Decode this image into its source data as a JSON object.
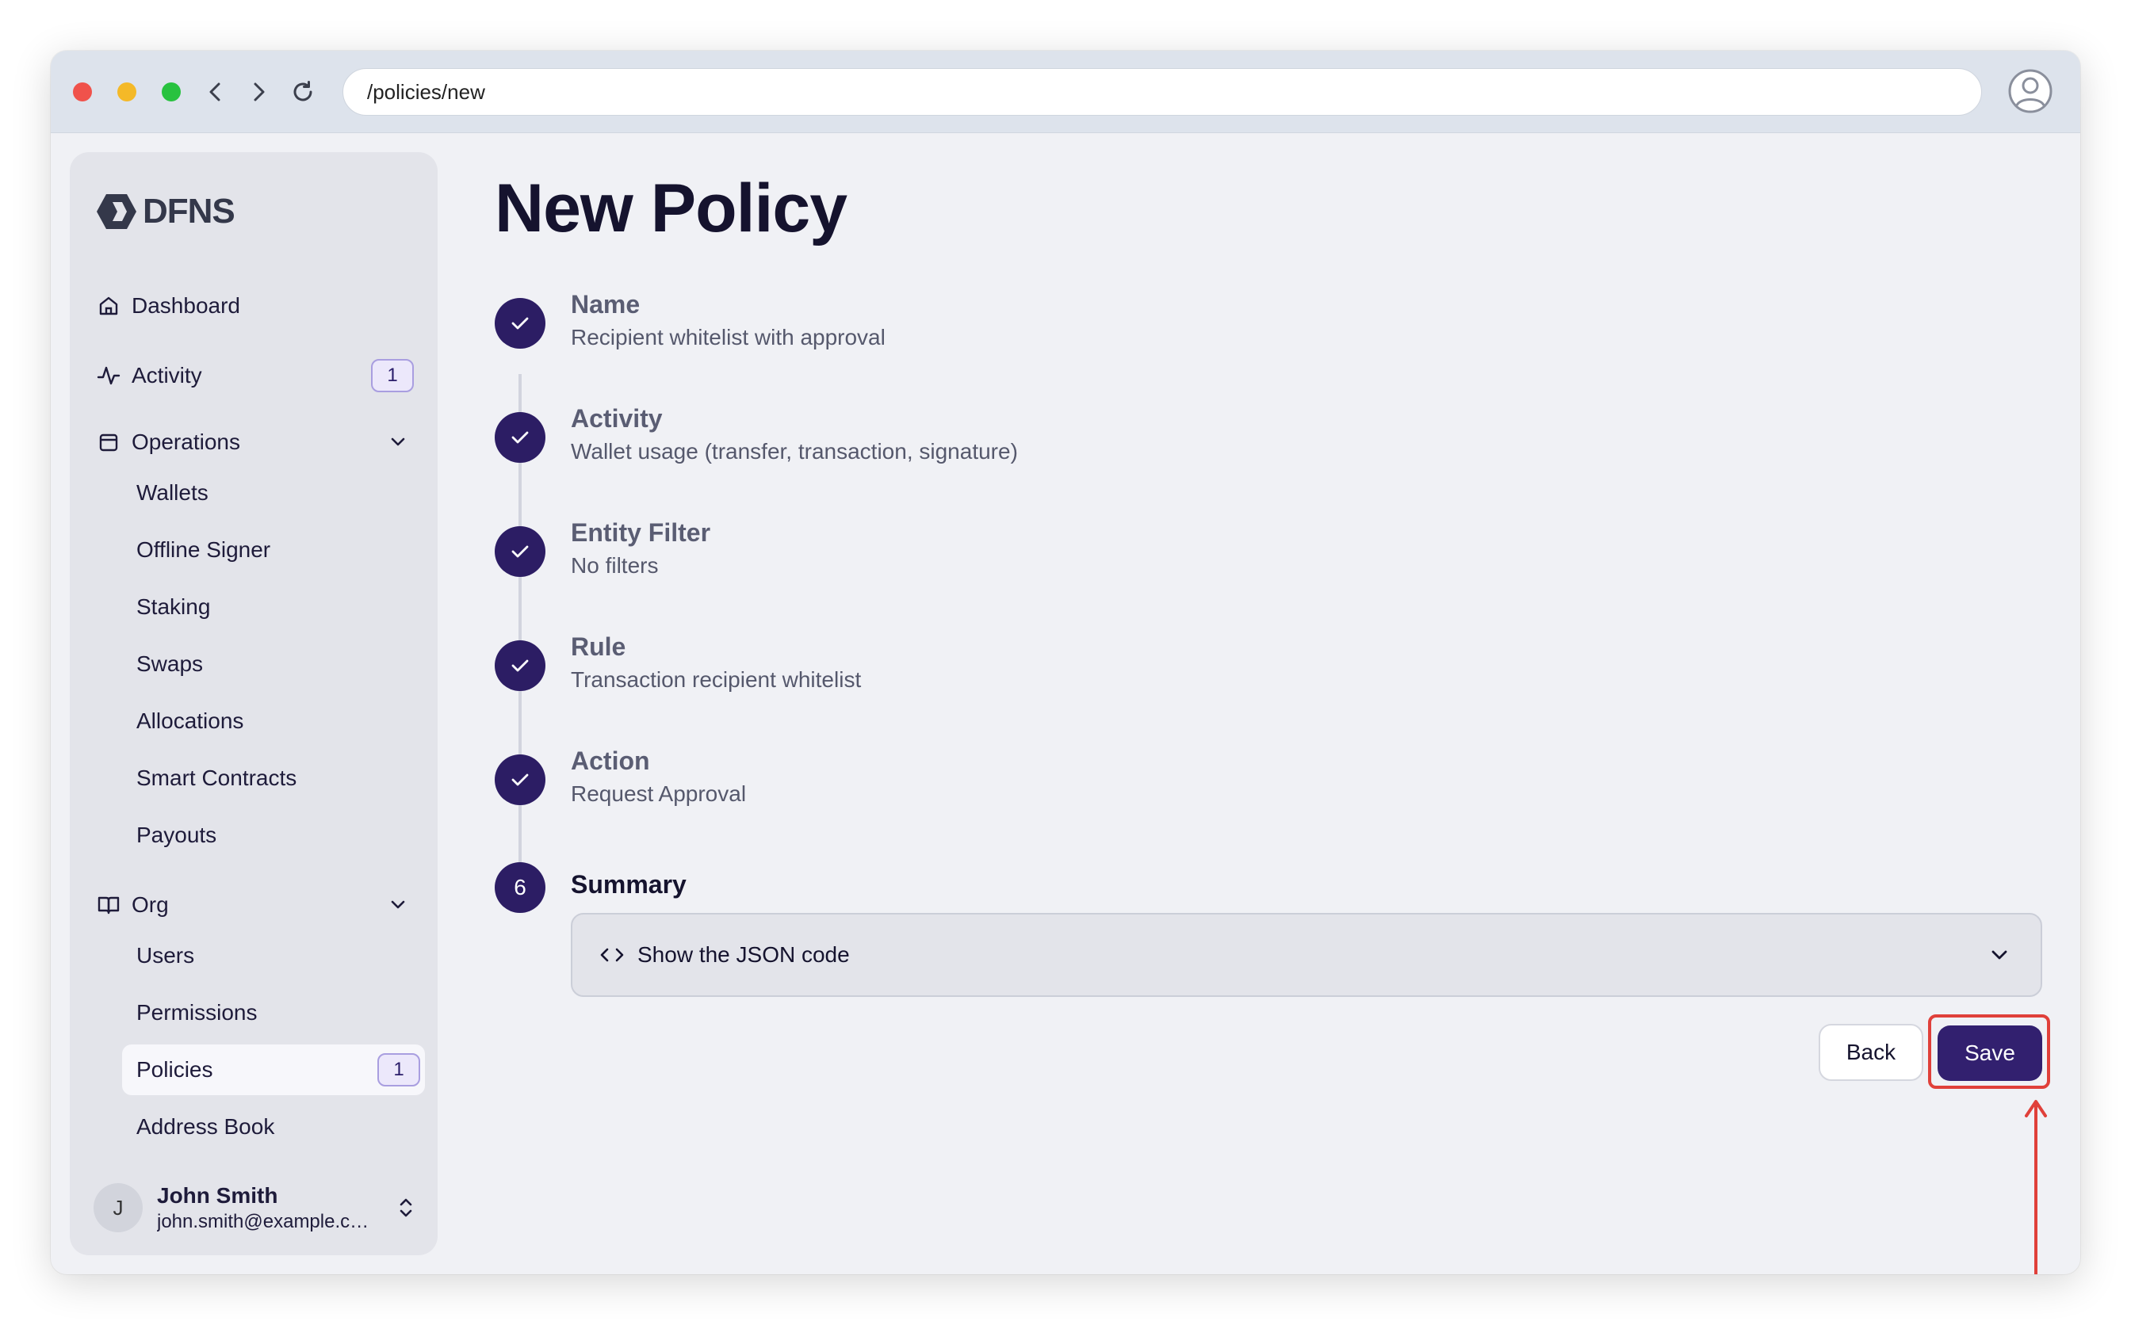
{
  "browser": {
    "url": "/policies/new",
    "nav_icons": [
      "back-icon",
      "forward-icon",
      "reload-icon",
      "profile-icon"
    ]
  },
  "brand": {
    "logo_text": "DFNS"
  },
  "sidebar": {
    "dashboard": {
      "label": "Dashboard",
      "icon": "home-icon"
    },
    "activity": {
      "label": "Activity",
      "badge": "1",
      "icon": "activity-icon"
    },
    "operations": {
      "label": "Operations",
      "icon": "calendar-icon",
      "items": [
        "Wallets",
        "Offline Signer",
        "Staking",
        "Swaps",
        "Allocations",
        "Smart Contracts",
        "Payouts"
      ]
    },
    "org": {
      "label": "Org",
      "icon": "book-icon",
      "items": [
        "Users",
        "Permissions",
        "Policies",
        "Address Book"
      ],
      "active": "Policies",
      "policies_badge": "1"
    },
    "user": {
      "initial": "J",
      "name": "John Smith",
      "email": "john.smith@example.com"
    }
  },
  "main": {
    "title": "New Policy",
    "steps": [
      {
        "title": "Name",
        "description": "Recipient whitelist with approval",
        "status": "complete"
      },
      {
        "title": "Activity",
        "description": "Wallet usage (transfer, transaction, signature)",
        "status": "complete"
      },
      {
        "title": "Entity Filter",
        "description": "No filters",
        "status": "complete"
      },
      {
        "title": "Rule",
        "description": "Transaction recipient whitelist",
        "status": "complete"
      },
      {
        "title": "Action",
        "description": "Request Approval",
        "status": "complete"
      },
      {
        "number": "6",
        "title": "Summary",
        "status": "current"
      }
    ],
    "json_toggle_label": "Show the JSON code",
    "back_label": "Back",
    "save_label": "Save"
  },
  "colors": {
    "primary": "#32206f",
    "step_circle": "#2c1d64",
    "highlight": "#e0403a",
    "badge_border": "#a99ee0"
  }
}
